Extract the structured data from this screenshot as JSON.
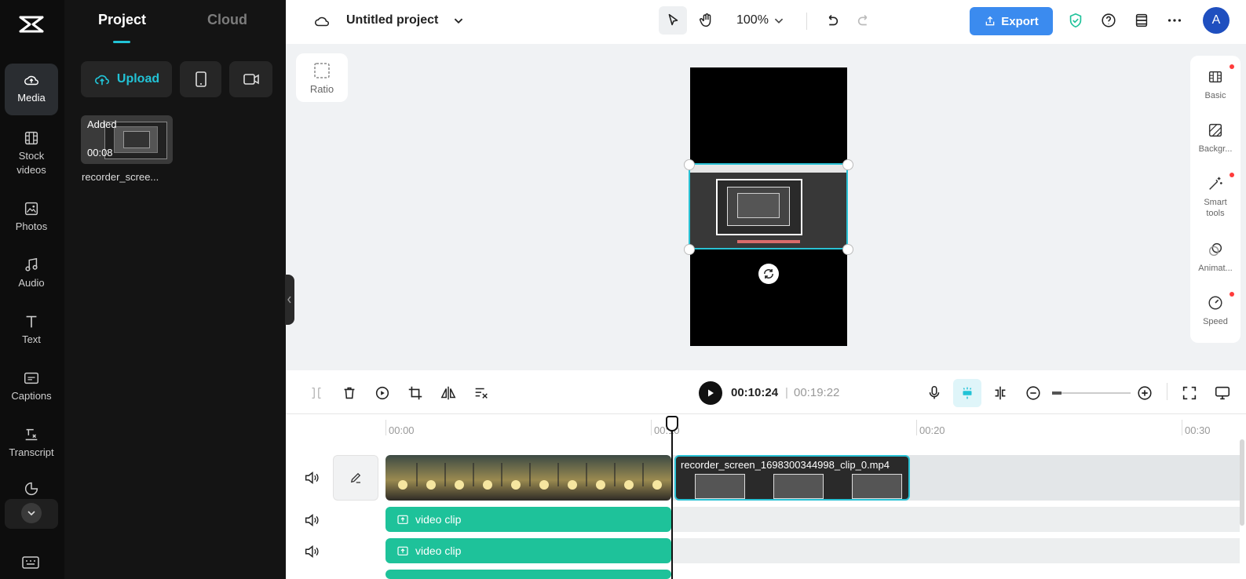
{
  "rail": {
    "items": [
      {
        "label": "Media"
      },
      {
        "label": "Stock videos"
      },
      {
        "label": "Photos"
      },
      {
        "label": "Audio"
      },
      {
        "label": "Text"
      },
      {
        "label": "Captions"
      },
      {
        "label": "Transcript"
      }
    ]
  },
  "panel": {
    "tabs": [
      "Project",
      "Cloud"
    ],
    "upload_label": "Upload",
    "media": {
      "badge": "Added",
      "duration": "00:08",
      "name": "recorder_scree..."
    }
  },
  "topbar": {
    "project_title": "Untitled project",
    "zoom": "100%",
    "export_label": "Export",
    "avatar_initial": "A"
  },
  "canvas": {
    "ratio_label": "Ratio"
  },
  "right_tools": [
    "Basic",
    "Backgr...",
    "Smart tools",
    "Animat...",
    "Speed"
  ],
  "timeline": {
    "current_time": "00:10:24",
    "separator": "|",
    "total_time": "00:19:22",
    "ticks": [
      "00:00",
      "00:10",
      "00:20",
      "00:30"
    ],
    "clip2_label": "recorder_screen_1698300344998_clip_0.mp4",
    "audio_clips": [
      "video clip",
      "video clip"
    ]
  },
  "colors": {
    "accent": "#22c3d6",
    "export": "#3b8bef",
    "audio": "#1ec29a"
  }
}
